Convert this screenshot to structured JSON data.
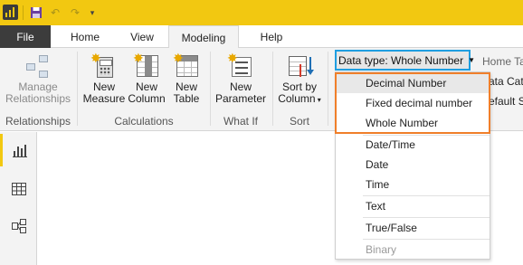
{
  "titlebar": {
    "icons": [
      "power-bi-logo",
      "save-icon",
      "undo-icon",
      "redo-icon",
      "customize-quick-access-icon"
    ],
    "accent_color": "#f2c811"
  },
  "tabs": {
    "file": "File",
    "items": [
      "Home",
      "View",
      "Modeling",
      "Help"
    ],
    "active": "Modeling"
  },
  "ribbon": {
    "relationships": {
      "manage_line1": "Manage",
      "manage_line2": "Relationships",
      "group": "Relationships"
    },
    "calculations": {
      "new_measure_line1": "New",
      "new_measure_line2": "Measure",
      "new_column_line1": "New",
      "new_column_line2": "Column",
      "new_table_line1": "New",
      "new_table_line2": "Table",
      "group": "Calculations"
    },
    "whatif": {
      "new_parameter_line1": "New",
      "new_parameter_line2": "Parameter",
      "group": "What If"
    },
    "sort": {
      "sort_line1": "Sort by",
      "sort_line2": "Column",
      "group": "Sort"
    },
    "data_type_label": "Data type: Whole Number",
    "home_table": "Home Tab",
    "data_category": "ata Cate",
    "default_summarization": "efault S"
  },
  "dropdown": {
    "highlight_color": "#f07f2a",
    "combobox_border_color": "#1f9ee0",
    "items": [
      {
        "label": "Decimal Number",
        "state": "hover"
      },
      {
        "label": "Fixed decimal number",
        "state": "normal"
      },
      {
        "label": "Whole Number",
        "state": "normal"
      },
      {
        "label": "Date/Time",
        "state": "normal"
      },
      {
        "label": "Date",
        "state": "normal"
      },
      {
        "label": "Time",
        "state": "normal"
      },
      {
        "label": "Text",
        "state": "normal"
      },
      {
        "label": "True/False",
        "state": "normal"
      },
      {
        "label": "Binary",
        "state": "disabled"
      }
    ]
  },
  "leftnav": {
    "items": [
      "report-view-icon",
      "data-view-icon",
      "model-view-icon"
    ],
    "active": "report-view-icon"
  }
}
